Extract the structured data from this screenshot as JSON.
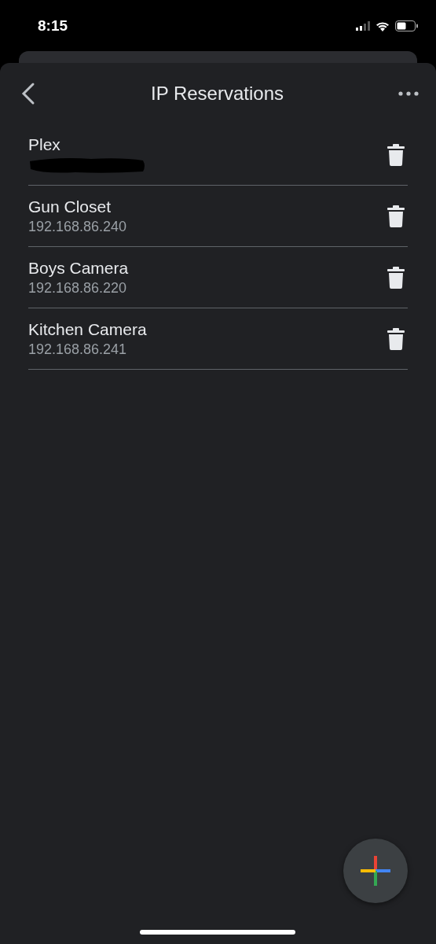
{
  "status_bar": {
    "time": "8:15"
  },
  "header": {
    "title": "IP Reservations"
  },
  "reservations": [
    {
      "name": "Plex",
      "redacted": true
    },
    {
      "name": "Gun Closet",
      "address": "192.168.86.240",
      "redacted": false
    },
    {
      "name": "Boys Camera",
      "address": "192.168.86.220",
      "redacted": false
    },
    {
      "name": "Kitchen Camera",
      "address": "192.168.86.241",
      "redacted": false
    }
  ]
}
